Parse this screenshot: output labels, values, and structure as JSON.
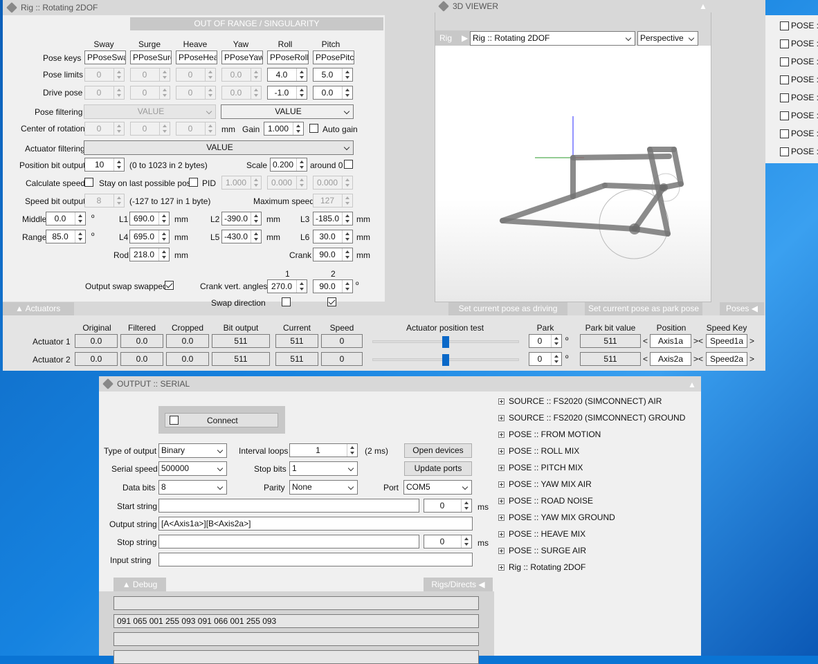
{
  "main": {
    "title": "Rig :: Rotating 2DOF",
    "warning": "OUT OF RANGE / SINGULARITY",
    "columns": [
      "Sway",
      "Surge",
      "Heave",
      "Yaw",
      "Roll",
      "Pitch"
    ],
    "pose_keys_label": "Pose keys",
    "pose_keys": [
      "PPoseSway",
      "PPoseSurge",
      "PPoseHeave",
      "PPoseYaw",
      "PPoseRoll",
      "PPosePitch"
    ],
    "pose_limits_label": "Pose limits",
    "pose_limits": [
      "0",
      "0",
      "0",
      "0.0",
      "4.0",
      "5.0"
    ],
    "drive_pose_label": "Drive pose",
    "drive_pose": [
      "0",
      "0",
      "0",
      "0.0",
      "-1.0",
      "0.0"
    ],
    "pose_filtering_label": "Pose filtering",
    "pose_filtering_a": "VALUE",
    "pose_filtering_b": "VALUE",
    "center_label": "Center of rotation",
    "center": [
      "0",
      "0",
      "0"
    ],
    "mm": "mm",
    "gain_label": "Gain",
    "gain": "1.000",
    "auto_gain": "Auto gain",
    "actuator_filtering_label": "Actuator filtering",
    "actuator_filtering": "VALUE",
    "pos_bit_label": "Position bit output",
    "pos_bit": "10",
    "pos_bit_range": "(0 to 1023 in 2 bytes)",
    "scale_label": "Scale",
    "scale": "0.200",
    "around_label": "around 0",
    "calc_speed_label": "Calculate speed",
    "stay_label": "Stay on last possible pose",
    "pid_label": "PID",
    "pid": [
      "1.000",
      "0.000",
      "0.000"
    ],
    "speed_bit_label": "Speed bit output",
    "speed_bit": "8",
    "speed_bit_range": "(-127 to 127 in 1 byte)",
    "max_speed_label": "Maximum speed",
    "max_speed": "127",
    "middle_label": "Middle",
    "middle": "0.0",
    "range_label": "Range",
    "range": "85.0",
    "deg": "º",
    "l1_label": "L1",
    "l1": "690.0",
    "l4_label": "L4",
    "l4": "695.0",
    "l2_label": "L2",
    "l2": "-390.0",
    "l5_label": "L5",
    "l5": "-430.0",
    "l3_label": "L3",
    "l3": "-185.0",
    "l6_label": "L6",
    "l6": "30.0",
    "rod_label": "Rod",
    "rod": "218.0",
    "crank_label": "Crank",
    "crank": "90.0",
    "col1": "1",
    "col2": "2",
    "output_swap_label": "Output swap swapped",
    "crank_angles_label": "Crank vert. angles",
    "crank_a1": "270.0",
    "crank_a2": "90.0",
    "swap_dir_label": "Swap direction",
    "actuators_tab": "Actuators",
    "set_driving": "Set current pose as driving pose",
    "set_park": "Set current pose as park pose",
    "poses_tab": "Poses"
  },
  "actuators": {
    "headers": [
      "Original",
      "Filtered",
      "Cropped",
      "Bit output",
      "Current",
      "Speed"
    ],
    "test_label": "Actuator position test",
    "park_label": "Park",
    "park_bit_label": "Park bit value",
    "pos_key_label": "Position Key",
    "speed_key_label": "Speed Key",
    "rows": [
      {
        "name": "Actuator 1",
        "vals": [
          "0.0",
          "0.0",
          "0.0",
          "511",
          "511",
          "0"
        ],
        "park": "0",
        "park_bit": "511",
        "pos_key": "Axis1a",
        "speed_key": "Speed1a",
        "slider": 0.5
      },
      {
        "name": "Actuator 2",
        "vals": [
          "0.0",
          "0.0",
          "0.0",
          "511",
          "511",
          "0"
        ],
        "park": "0",
        "park_bit": "511",
        "pos_key": "Axis2a",
        "speed_key": "Speed2a",
        "slider": 0.5
      }
    ]
  },
  "viewer": {
    "title": "3D VIEWER",
    "rig_label": "Rig",
    "rig_select": "Rig :: Rotating 2DOF",
    "view_select": "Perspective"
  },
  "right_poses": [
    "POSE ::",
    "POSE ::",
    "POSE ::",
    "POSE ::",
    "POSE ::",
    "POSE ::",
    "POSE ::",
    "POSE ::"
  ],
  "serial": {
    "title": "OUTPUT :: SERIAL",
    "connect": "Connect",
    "type_label": "Type of output",
    "type": "Binary",
    "interval_label": "Interval loops",
    "interval": "1",
    "interval_ms": "(2 ms)",
    "open_devices": "Open devices",
    "speed_label": "Serial speed",
    "speed": "500000",
    "stop_bits_label": "Stop bits",
    "stop_bits": "1",
    "update_ports": "Update ports",
    "data_bits_label": "Data bits",
    "data_bits": "8",
    "parity_label": "Parity",
    "parity": "None",
    "port_label": "Port",
    "port": "COM5",
    "start_label": "Start string",
    "start": "",
    "start_ms": "0",
    "ms": "ms",
    "output_label": "Output string",
    "output": "[A<Axis1a>][B<Axis2a>]",
    "stop_label": "Stop string",
    "stop": "",
    "stop_ms": "0",
    "input_label": "Input string",
    "input": "",
    "debug_tab": "Debug",
    "rigs_tab": "Rigs/Directs",
    "debug_line": "091 065 001 255 093 091 066 001 255 093"
  },
  "tree": [
    "SOURCE :: FS2020 (SIMCONNECT) AIR",
    "SOURCE :: FS2020 (SIMCONNECT) GROUND",
    "POSE :: FROM MOTION",
    "POSE :: ROLL MIX",
    "POSE :: PITCH MIX",
    "POSE :: YAW MIX AIR",
    "POSE :: ROAD NOISE",
    "POSE :: YAW MIX GROUND",
    "POSE :: HEAVE MIX",
    "POSE :: SURGE AIR",
    "Rig :: Rotating 2DOF"
  ]
}
